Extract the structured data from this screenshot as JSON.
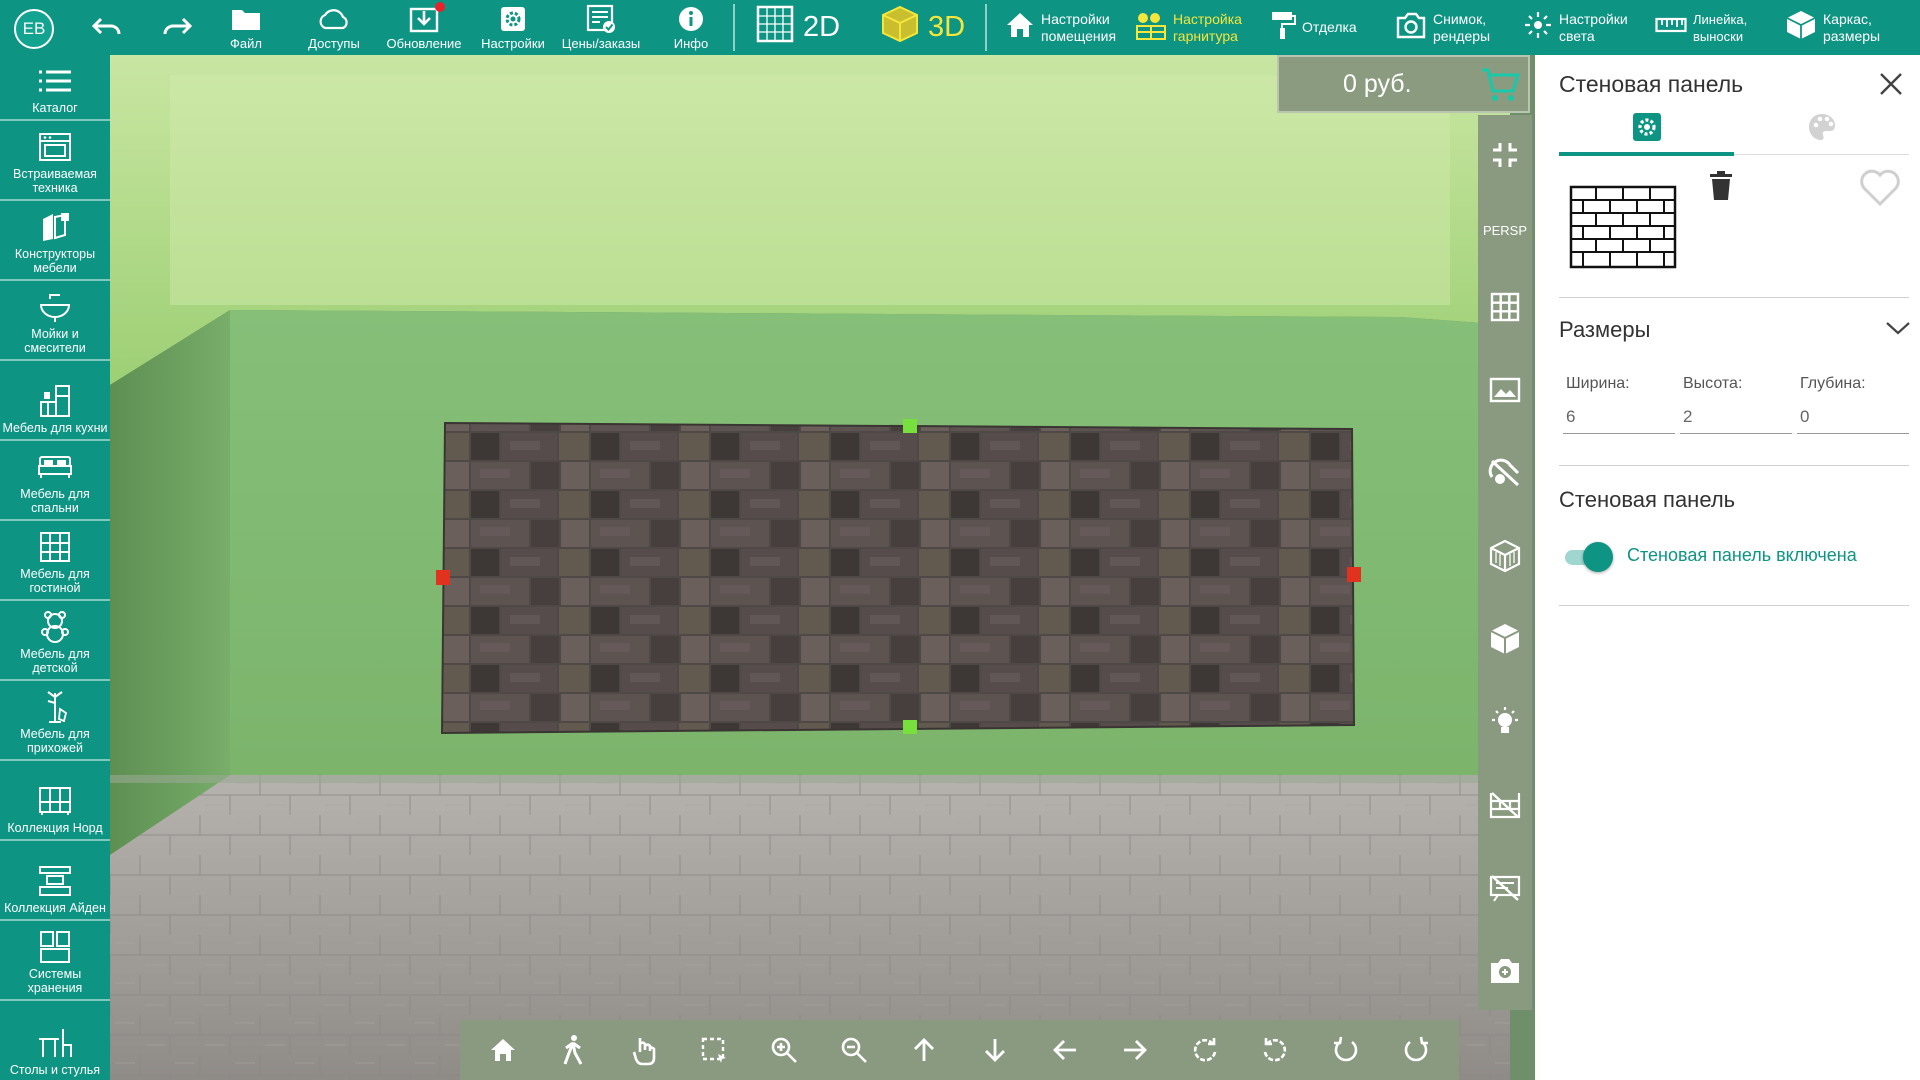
{
  "app": {
    "user_initials": "EB",
    "accent_color": "#0e9483",
    "highlight_color": "#f5e63c"
  },
  "toolbar": {
    "undo_icon": "undo-icon",
    "redo_icon": "redo-icon",
    "buttons": [
      {
        "label": "Файл",
        "icon": "folder-icon"
      },
      {
        "label": "Доступы",
        "icon": "cloud-icon"
      },
      {
        "label": "Обновление",
        "icon": "download-icon",
        "badge": true
      },
      {
        "label": "Настройки",
        "icon": "settings-icon"
      },
      {
        "label": "Цены/заказы",
        "icon": "prices-icon"
      },
      {
        "label": "Инфо",
        "icon": "info-icon"
      }
    ],
    "mode_2d": "2D",
    "mode_3d": "3D",
    "active_mode": "3D",
    "right_items": [
      {
        "line1": "Настройки",
        "line2": "помещения",
        "icon": "home-icon"
      },
      {
        "line1": "Настройка",
        "line2": "гарнитура",
        "icon": "kitchen-set-icon",
        "active": true
      },
      {
        "line1": "Отделка",
        "line2": "",
        "icon": "paint-roller-icon"
      },
      {
        "line1": "Снимок,",
        "line2": "рендеры",
        "icon": "camera-icon"
      },
      {
        "line1": "Настройки",
        "line2": "света",
        "icon": "light-icon"
      },
      {
        "line1": "Линейка,",
        "line2": "выноски",
        "icon": "ruler-icon"
      },
      {
        "line1": "Каркас,",
        "line2": "размеры",
        "icon": "box-icon"
      }
    ]
  },
  "sidebar": {
    "items": [
      {
        "label": "Каталог",
        "icon": "list-icon"
      },
      {
        "label": "Встраиваемая техника",
        "icon": "oven-icon"
      },
      {
        "label": "Конструкторы мебели",
        "icon": "furniture-constructor-icon"
      },
      {
        "label": "Мойки и смесители",
        "icon": "sink-icon"
      },
      {
        "label": "Мебель для кухни",
        "icon": "kitchen-icon"
      },
      {
        "label": "Мебель для спальни",
        "icon": "bed-icon"
      },
      {
        "label": "Мебель для гостиной",
        "icon": "wardrobe-icon"
      },
      {
        "label": "Мебель для детской",
        "icon": "teddy-bear-icon"
      },
      {
        "label": "Мебель для прихожей",
        "icon": "coat-rack-icon"
      },
      {
        "label": "Коллекция Норд",
        "icon": "nord-collection-icon"
      },
      {
        "label": "Коллекция Айден",
        "icon": "aiden-collection-icon"
      },
      {
        "label": "Системы хранения",
        "icon": "storage-icon"
      },
      {
        "label": "Столы и стулья",
        "icon": "table-chair-icon"
      }
    ]
  },
  "viewport": {
    "price": "0 руб.",
    "cart_icon": "cart-icon",
    "tools": [
      {
        "name": "collapse-icon"
      },
      {
        "name": "persp-toggle",
        "label": "PERSP"
      },
      {
        "name": "grid-icon"
      },
      {
        "name": "image-icon"
      },
      {
        "name": "texture-off-icon"
      },
      {
        "name": "wireframe-cube-icon"
      },
      {
        "name": "solid-cube-icon"
      },
      {
        "name": "lamp-icon"
      },
      {
        "name": "hide-walls-icon"
      },
      {
        "name": "hide-labels-icon"
      },
      {
        "name": "screenshot-icon"
      }
    ],
    "nav": [
      "home-view-icon",
      "walk-icon",
      "pointer-hand-icon",
      "select-area-icon",
      "zoom-in-icon",
      "zoom-out-icon",
      "arrow-up-icon",
      "arrow-down-icon",
      "arrow-left-icon",
      "arrow-right-icon",
      "rotate-cw-icon",
      "rotate-ccw-icon",
      "orbit-left-icon",
      "orbit-right-icon"
    ]
  },
  "panel": {
    "title": "Стеновая панель",
    "tabs": [
      {
        "icon": "gear-icon",
        "active": true
      },
      {
        "icon": "palette-icon",
        "active": false
      }
    ],
    "dimensions_title": "Размеры",
    "width_label": "Ширина:",
    "width_value": "6",
    "height_label": "Высота:",
    "height_value": "2",
    "depth_label": "Глубина:",
    "depth_value": "0",
    "section_title": "Стеновая панель",
    "toggle_label": "Стеновая панель включена",
    "toggle_on": true
  }
}
